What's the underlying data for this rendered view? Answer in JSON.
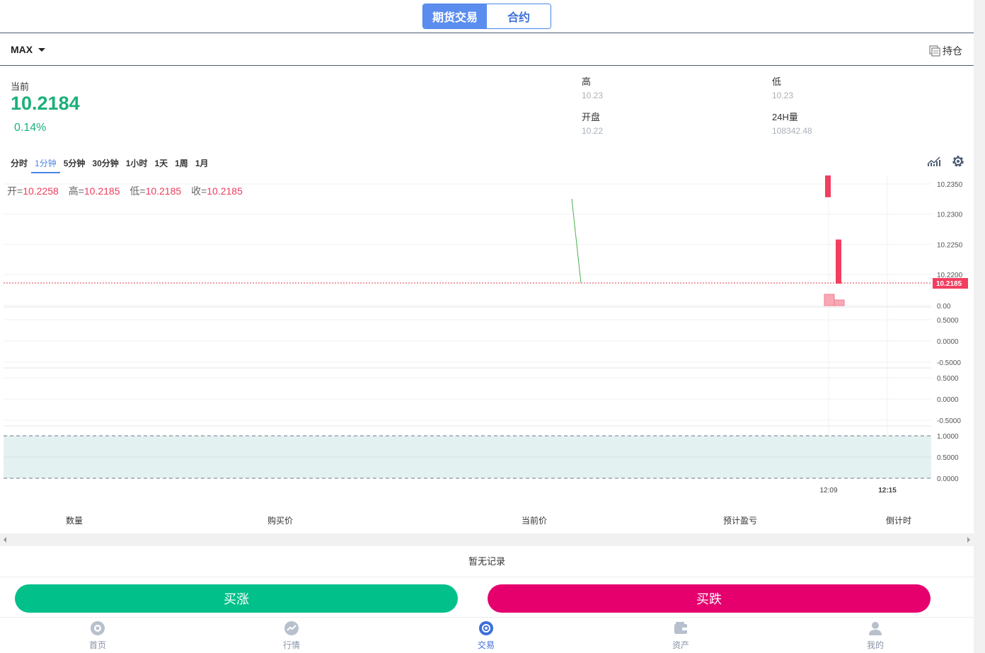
{
  "tabs": {
    "futures": "期货交易",
    "contract": "合约"
  },
  "symbol": {
    "name": "MAX"
  },
  "holdings": {
    "label": "持仓"
  },
  "current": {
    "label": "当前",
    "price": "10.2184",
    "change_pct": "0.14%"
  },
  "stats": {
    "high_label": "高",
    "high_value": "10.23",
    "low_label": "低",
    "low_value": "10.23",
    "open_label": "开盘",
    "open_value": "10.22",
    "vol_label": "24H量",
    "vol_value": "108342.48"
  },
  "timeframes": [
    "分时",
    "1分钟",
    "5分钟",
    "30分钟",
    "1小时",
    "1天",
    "1周",
    "1月"
  ],
  "timeframe_active": "1分钟",
  "ohlc": {
    "open_label": "开=",
    "open": "10.2258",
    "high_label": "高=",
    "high": "10.2185",
    "low_label": "低=",
    "low": "10.2185",
    "close_label": "收=",
    "close": "10.2185"
  },
  "chart_data": {
    "type": "candlestick",
    "price_ticks": [
      "10.2350",
      "10.2300",
      "10.2250",
      "10.2200"
    ],
    "last_price_tag": "10.2185",
    "ind1_ticks": [
      "0.00"
    ],
    "ind2_ticks": [
      "0.5000",
      "0.0000",
      "-0.5000"
    ],
    "ind3_ticks": [
      "0.5000",
      "0.0000",
      "-0.5000"
    ],
    "ind4_ticks": [
      "1.0000",
      "0.5000",
      "0.0000"
    ],
    "time_labels": [
      "12:09",
      "12:15"
    ],
    "candles": [
      {
        "time": "12:09",
        "open": 10.2365,
        "close": 10.2328
      },
      {
        "time": "12:10",
        "open": 10.2258,
        "close": 10.2185
      }
    ],
    "line": [
      [
        10.2328,
        "start"
      ],
      [
        10.2185,
        "end"
      ]
    ],
    "colors": {
      "down": "#f23e5f",
      "up": "#02c08a",
      "line": "#4caf50",
      "area": "#e3f1f1"
    }
  },
  "table": {
    "columns": [
      "数量",
      "购买价",
      "当前价",
      "预计盈亏",
      "倒计时"
    ],
    "empty_text": "暂无记录"
  },
  "actions": {
    "buy_up": "买涨",
    "buy_down": "买跌"
  },
  "nav": [
    {
      "label": "首页",
      "icon": "home-icon"
    },
    {
      "label": "行情",
      "icon": "market-icon"
    },
    {
      "label": "交易",
      "icon": "trade-icon",
      "active": true
    },
    {
      "label": "资产",
      "icon": "wallet-icon"
    },
    {
      "label": "我的",
      "icon": "user-icon"
    }
  ]
}
